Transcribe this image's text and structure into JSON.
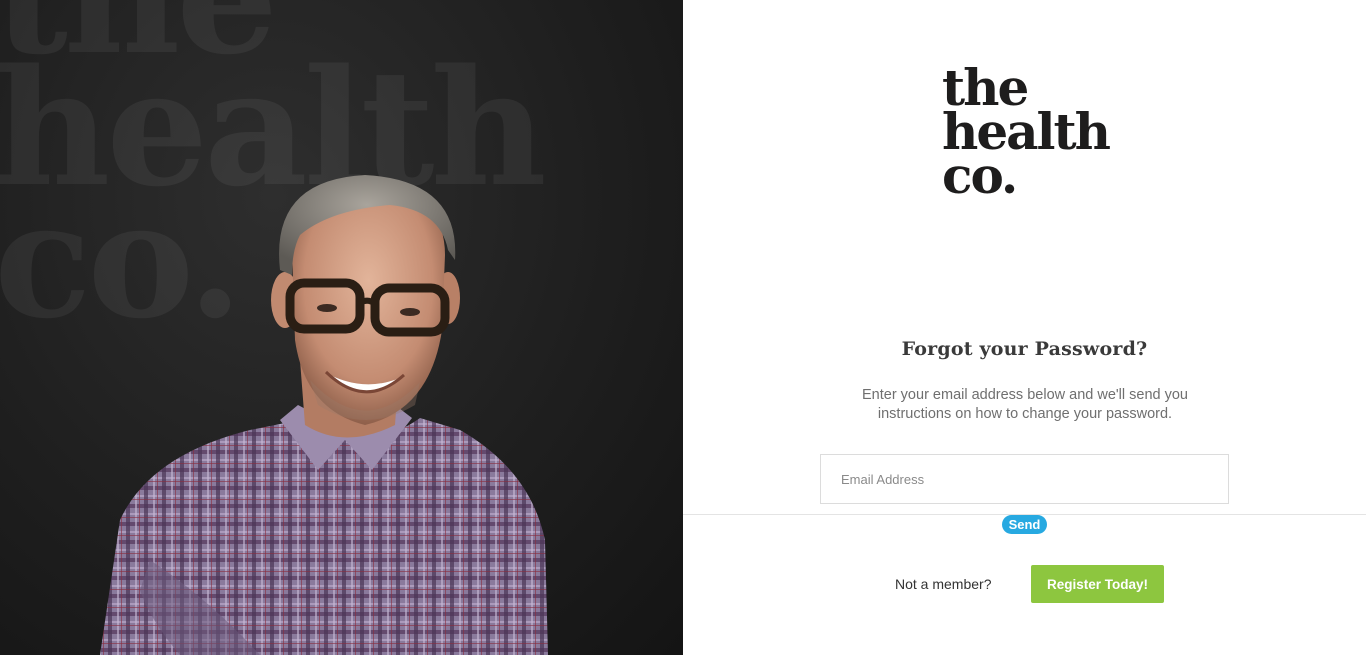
{
  "brand": {
    "logo_lines": [
      "the",
      "health",
      "co."
    ],
    "hero_watermark": "the\nhealth\nco."
  },
  "form": {
    "heading": "Forgot your Password?",
    "instructions": "Enter your email address below and we'll send you instructions on how to change your password.",
    "email_placeholder": "Email Address",
    "email_value": "",
    "send_label": "Send"
  },
  "footer": {
    "not_member_text": "Not a member?",
    "register_label": "Register Today!"
  },
  "colors": {
    "send_button": "#27a9e1",
    "register_button": "#8dc63f",
    "logo_text": "#1e1d1d",
    "hero_background": "#1f1f1f"
  },
  "icons": {
    "hero_photo": "smiling-man-with-glasses-photo"
  }
}
